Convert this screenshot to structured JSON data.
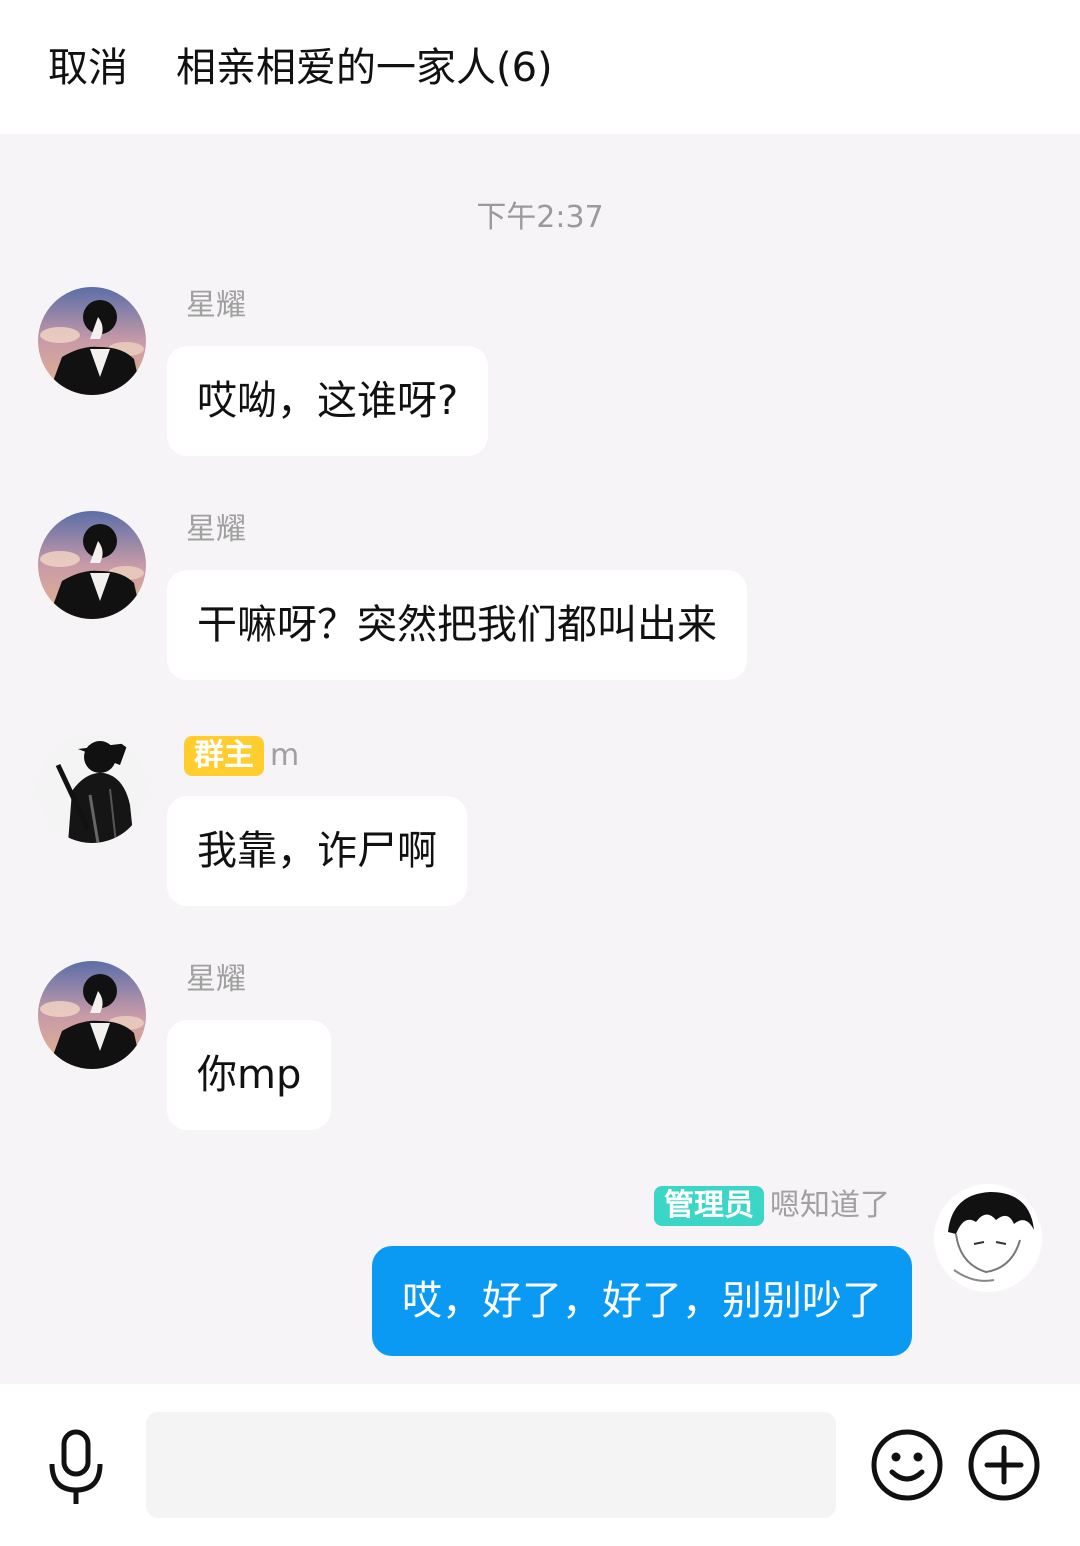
{
  "header": {
    "cancel_label": "取消",
    "title": "相亲相爱的一家人(6)"
  },
  "chat": {
    "timestamp": "下午2:37",
    "messages": [
      {
        "sender": "星耀",
        "text": "哎呦，这谁呀?",
        "avatar": "dark-silhouette-sunset-avatar"
      },
      {
        "sender": "星耀",
        "text": "干嘛呀？突然把我们都叫出来",
        "avatar": "dark-silhouette-sunset-avatar"
      },
      {
        "badge": "群主",
        "sender": "m",
        "text": "我靠，诈尸啊",
        "avatar": "black-white-figure-avatar"
      },
      {
        "sender": "星耀",
        "text": "你mp",
        "avatar": "dark-silhouette-sunset-avatar"
      },
      {
        "badge": "管理员",
        "sender": "嗯知道了",
        "text": "哎，好了，好了，别别吵了",
        "avatar": "sketch-boy-avatar",
        "mine": true
      }
    ]
  },
  "input_bar": {
    "placeholder": ""
  },
  "colors": {
    "accent_blue": "#0a9af3",
    "owner_badge": "#ffcd2e",
    "admin_badge": "#3cd6c6",
    "chat_background": "#f6f4f6"
  },
  "icons": [
    "microphone-icon",
    "emoji-icon",
    "plus-icon"
  ]
}
